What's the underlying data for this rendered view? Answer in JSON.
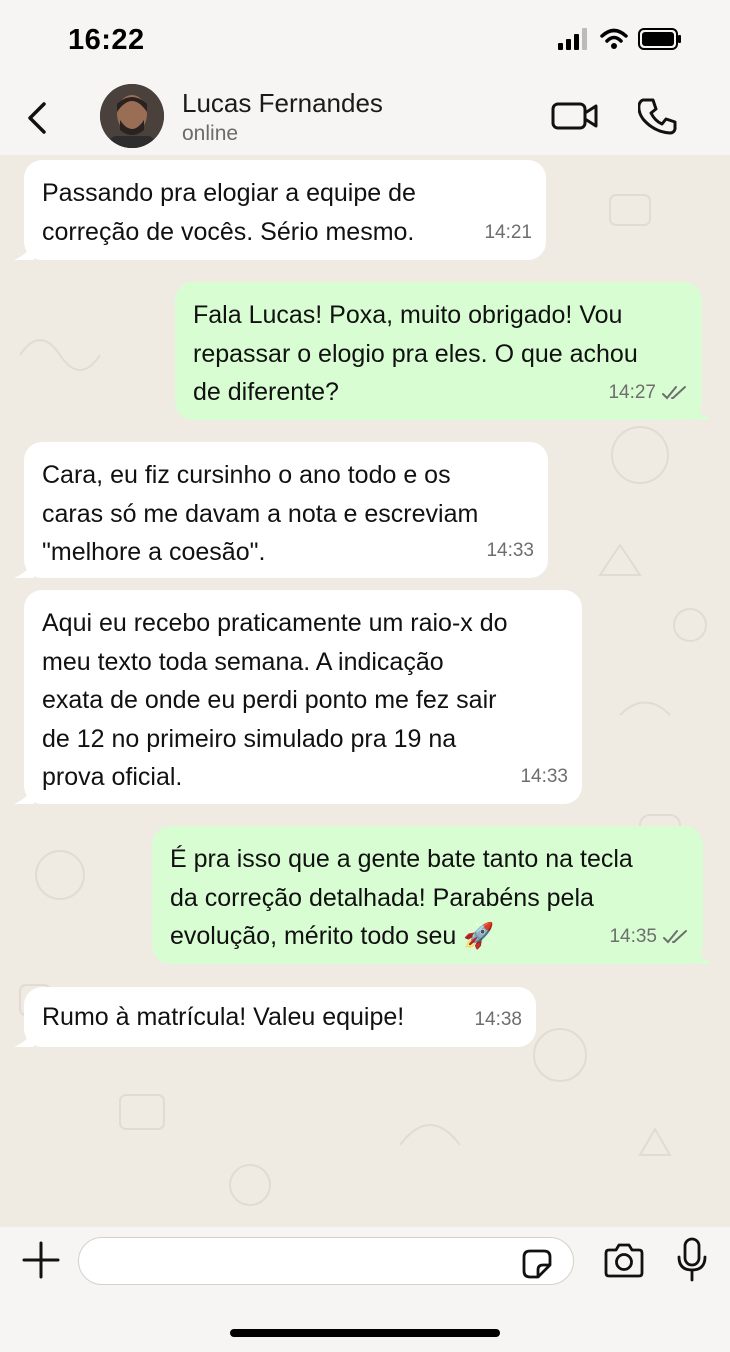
{
  "status_bar": {
    "time": "16:22",
    "icons": [
      "signal-icon",
      "wifi-icon",
      "battery-icon"
    ]
  },
  "header": {
    "contact_name": "Lucas Fernandes",
    "contact_status": "online",
    "icons": [
      "back-icon",
      "avatar",
      "video-call-icon",
      "phone-icon"
    ]
  },
  "messages": [
    {
      "direction": "in",
      "text": "Passando pra elogiar a equipe de\ncorreção de vocês. Sério mesmo.",
      "time": "14:21"
    },
    {
      "direction": "out",
      "text": "Fala Lucas! Poxa, muito obrigado! Vou\nrepassar o elogio pra eles. O que achou\nde diferente?",
      "time": "14:27",
      "read": true
    },
    {
      "direction": "in",
      "text": "Cara, eu fiz cursinho o ano todo e os\ncaras só me davam a nota e escreviam\n\"melhore a coesão\".",
      "time": "14:33"
    },
    {
      "direction": "in",
      "text": "Aqui eu recebo praticamente um raio-x do\nmeu texto toda semana. A indicação\nexata de onde eu perdi ponto me fez sair\nde 12 no primeiro simulado pra 19 na\nprova oficial.",
      "time": "14:33"
    },
    {
      "direction": "out",
      "text": "É pra isso que a gente bate tanto na tecla\nda correção detalhada! Parabéns pela\nevolução, mérito todo seu 🚀",
      "time": "14:35",
      "read": true
    },
    {
      "direction": "in",
      "text": "Rumo à matrícula! Valeu equipe!",
      "time": "14:38"
    }
  ],
  "composer": {
    "input_value": "",
    "icons": [
      "plus-icon",
      "sticker-icon",
      "camera-icon",
      "microphone-icon"
    ]
  },
  "colors": {
    "incoming_bubble": "#ffffff",
    "outgoing_bubble": "#d9fdd3",
    "background": "#efeae2",
    "read_ticks": "#6e6e6e"
  }
}
